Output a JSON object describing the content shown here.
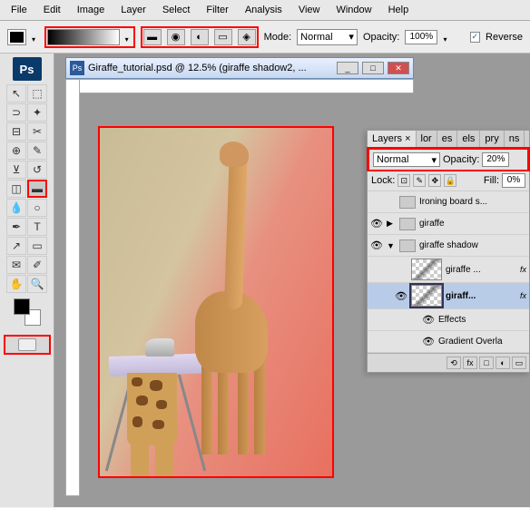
{
  "menu": [
    "File",
    "Edit",
    "Image",
    "Layer",
    "Select",
    "Filter",
    "Analysis",
    "View",
    "Window",
    "Help"
  ],
  "optbar": {
    "mode_label": "Mode:",
    "mode_value": "Normal",
    "opacity_label": "Opacity:",
    "opacity_value": "100%",
    "reverse_label": "Reverse",
    "reverse_checked": "✓"
  },
  "app_badge": "Ps",
  "doc": {
    "title": "Giraffe_tutorial.psd @ 12.5% (giraffe shadow2, ..."
  },
  "panel": {
    "tabs": [
      "Layers ×",
      "lor",
      "es",
      "els",
      "pry",
      "ns"
    ],
    "blend_value": "Normal",
    "opacity_label": "Opacity:",
    "opacity_value": "20%",
    "lock_label": "Lock:",
    "fill_label": "Fill:",
    "fill_value": "0%",
    "layers": [
      {
        "eye": "",
        "arrow": "",
        "folder": false,
        "name": "Ironing board s..."
      },
      {
        "eye": "👁",
        "arrow": "▶",
        "folder": true,
        "name": "giraffe"
      },
      {
        "eye": "👁",
        "arrow": "▼",
        "folder": true,
        "name": "giraffe shadow"
      },
      {
        "eye": "",
        "arrow": "",
        "thumb": true,
        "name": "giraffe ...",
        "fx": "fx"
      },
      {
        "eye": "👁",
        "arrow": "",
        "thumb": true,
        "sel": true,
        "name": "giraff...",
        "fx": "fx"
      }
    ],
    "effects_label": "Effects",
    "gradient_overlay_label": "Gradient Overla"
  }
}
